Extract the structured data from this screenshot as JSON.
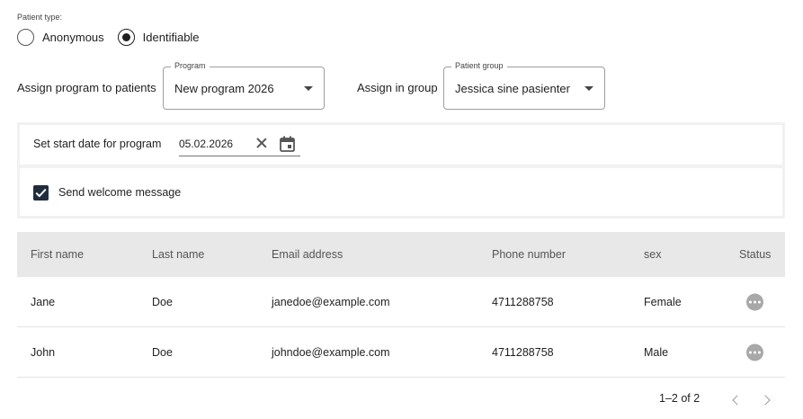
{
  "patient_type": {
    "label": "Patient type:",
    "options": [
      {
        "label": "Anonymous",
        "checked": false
      },
      {
        "label": "Identifiable",
        "checked": true
      }
    ]
  },
  "assign": {
    "program_label": "Assign program to patients",
    "program_legend": "Program",
    "program_value": "New program 2026",
    "group_label": "Assign in group",
    "group_legend": "Patient group",
    "group_value": "Jessica sine pasienter"
  },
  "start_date": {
    "label": "Set start date for program",
    "value": "05.02.2026"
  },
  "welcome": {
    "label": "Send welcome message",
    "checked": true
  },
  "table": {
    "columns": [
      "First name",
      "Last name",
      "Email address",
      "Phone number",
      "sex",
      "Status"
    ],
    "rows": [
      {
        "first": "Jane",
        "last": "Doe",
        "email": "janedoe@example.com",
        "phone": "4711288758",
        "sex": "Female",
        "status": "more-icon"
      },
      {
        "first": "John",
        "last": "Doe",
        "email": "johndoe@example.com",
        "phone": "4711288758",
        "sex": "Male",
        "status": "more-icon"
      }
    ]
  },
  "pagination": {
    "range": "1–2 of 2"
  },
  "colors": {
    "header_bg": "#e8e8e8",
    "checkbox_fill": "#1f2d3d",
    "status_icon": "#a8a8a8"
  }
}
